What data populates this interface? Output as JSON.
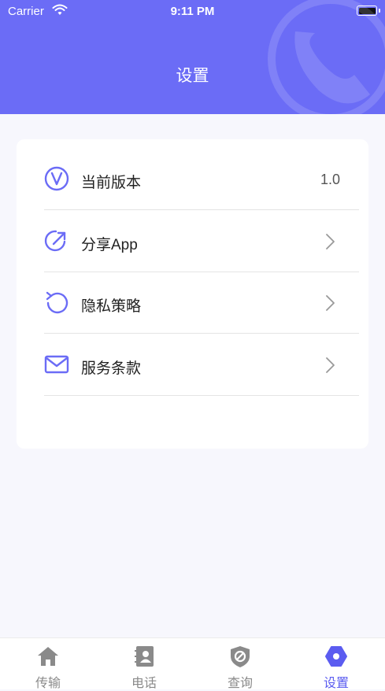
{
  "status_bar": {
    "carrier": "Carrier",
    "time": "9:11 PM"
  },
  "header": {
    "title": "设置",
    "background": "#6b6cf6"
  },
  "settings": {
    "items": [
      {
        "icon": "version-check-icon",
        "label": "当前版本",
        "value": "1.0"
      },
      {
        "icon": "share-icon",
        "label": "分享App"
      },
      {
        "icon": "refresh-icon",
        "label": "隐私策略"
      },
      {
        "icon": "mail-icon",
        "label": "服务条款"
      }
    ]
  },
  "tabbar": {
    "tabs": [
      {
        "icon": "home-icon",
        "label": "传输"
      },
      {
        "icon": "contacts-icon",
        "label": "电话"
      },
      {
        "icon": "block-icon",
        "label": "查询"
      },
      {
        "icon": "settings-hexagon-icon",
        "label": "设置",
        "active": true
      }
    ],
    "active_color": "#5b5cf0",
    "inactive_color": "#8a8a8a"
  }
}
